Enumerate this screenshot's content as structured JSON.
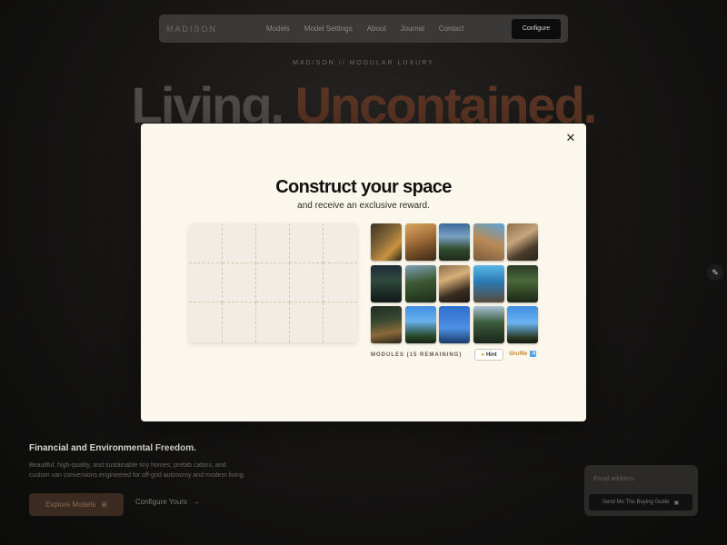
{
  "nav": {
    "brand": "MADISON",
    "links": [
      "Models",
      "Model Settings",
      "About",
      "Journal",
      "Contact"
    ],
    "configure_label": "Configure"
  },
  "hero": {
    "eyebrow": "MADISON // MODULAR LUXURY",
    "word1": "Living.",
    "word2": "Uncontained."
  },
  "footer": {
    "title": "Financial and Environmental Freedom.",
    "description": "Beautiful, high-quality, and sustainable tiny homes, prefab cabins, and custom van conversions engineered for off-grid autonomy and modern living.",
    "explore_label": "Explore Models",
    "configure_label": "Configure Yours"
  },
  "guide": {
    "email_placeholder": "Email address",
    "send_label": "Send Me The Buying Guide"
  },
  "modal": {
    "close_icon": "close-icon",
    "title": "Construct your space",
    "subtitle": "and receive an exclusive reward.",
    "tray_label": "MODULES (15 REMAINING)",
    "hint_label": "Hint",
    "shuffle_label": "Shuffle",
    "tiles": [
      {
        "name": "tile-1",
        "bg": "linear-gradient(135deg,#3b3324 0%,#8a6a3a 45%,#c8923f 70%,#2a2419 100%)"
      },
      {
        "name": "tile-2",
        "bg": "linear-gradient(160deg,#d8a762 0%,#a9743c 40%,#6e4a26 70%,#3b2a18 100%)"
      },
      {
        "name": "tile-3",
        "bg": "linear-gradient(180deg,#3b6a9a 0%,#7aa0c4 35%,#2f4a2a 70%,#1f2a1a 100%)"
      },
      {
        "name": "tile-4",
        "bg": "linear-gradient(200deg,#5aa5d6 0%,#b98a57 50%,#7a5a3c 100%)"
      },
      {
        "name": "tile-5",
        "bg": "linear-gradient(150deg,#8c6f4e 0%,#c7a57c 40%,#4a3b2a 70%,#2a2418 100%)"
      },
      {
        "name": "tile-6",
        "bg": "linear-gradient(180deg,#1d2a34 0%,#2f4a3e 40%,#101618 100%)"
      },
      {
        "name": "tile-7",
        "bg": "linear-gradient(170deg,#7ea0b8 0%,#3d5a32 45%,#1e2c18 100%)"
      },
      {
        "name": "tile-8",
        "bg": "linear-gradient(160deg,#8a6c4a 0%,#d7b07a 35%,#3a2e20 70%,#1a1510 100%)"
      },
      {
        "name": "tile-9",
        "bg": "linear-gradient(180deg,#5ab7e6 0%,#2a7ab3 45%,#5a4a3a 100%)"
      },
      {
        "name": "tile-10",
        "bg": "linear-gradient(180deg,#2a3a24 0%,#4a6a3a 40%,#1c2616 100%)"
      },
      {
        "name": "tile-11",
        "bg": "linear-gradient(170deg,#1f2a24 0%,#3a4a30 40%,#8a6a3a 70%,#2a2418 100%)"
      },
      {
        "name": "tile-12",
        "bg": "linear-gradient(180deg,#3f8ee0 0%,#6ab2f0 40%,#2a4a2a 80%,#182218 100%)"
      },
      {
        "name": "tile-13",
        "bg": "linear-gradient(180deg,#2e6fcf 0%,#4d8fe2 60%,#1a3a6a 100%)"
      },
      {
        "name": "tile-14",
        "bg": "linear-gradient(180deg,#a9c3d8 0%,#3a5a3a 45%,#1a241a 100%)"
      },
      {
        "name": "tile-15",
        "bg": "linear-gradient(180deg,#3f8ee0 0%,#6ab2f0 45%,#2a3a22 85%,#141a12 100%)"
      }
    ]
  }
}
